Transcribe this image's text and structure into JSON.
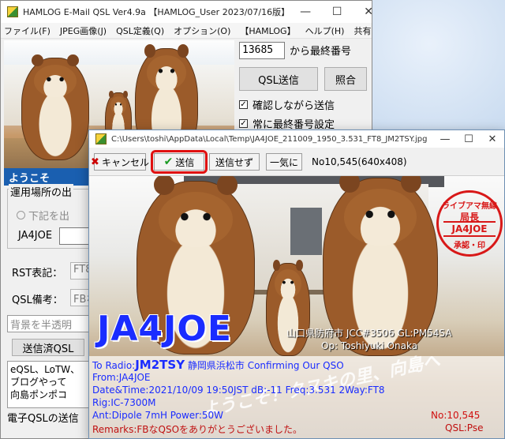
{
  "back_window": {
    "title": "HAMLOG E-Mail QSL Ver4.9a 【HAMLOG_User 2023/07/16版】",
    "caption": {
      "minimize": "—",
      "maximize": "☐",
      "close": "✕"
    },
    "menu": [
      "ファイル(F)",
      "JPEG画像(J)",
      "QSL定義(Q)",
      "オプション(O)",
      "【HAMLOG】",
      "ヘルプ(H)",
      "共有"
    ],
    "photo_sign": "ようこそ",
    "last_number_value": "13685",
    "last_number_label": "から最終番号",
    "send_qsl_button": "QSL送信",
    "verify_button": "照合",
    "check_confirm": "確認しながら送信",
    "check_always_last": "常に最終番号設定",
    "operating_place_title": "運用場所の出",
    "radio_option": "下記を出",
    "callsign_label": "JA4JOE",
    "rst_label": "RST表記：",
    "rst_value": "FT8",
    "qsl_note_label": "QSL備考：",
    "qsl_note_value": "FBな",
    "background_field": "背景を半透明",
    "sent_qsl_button": "送信済QSL",
    "memo_text": "eQSL、LoTW、\nブログやって\n向島ポンポコ",
    "status_text": "電子QSLの送信"
  },
  "front_window": {
    "title": "C:\\Users\\toshi\\AppData\\Local\\Temp\\JA4JOE_211009_1950_3.531_FT8_JM2TSY.jpg",
    "caption": {
      "minimize": "—",
      "maximize": "☐",
      "close": "✕"
    },
    "toolbar": {
      "cancel": "キャンセル",
      "send": "送信",
      "dont_send": "送信せず",
      "send_all": "一気に",
      "image_info": "No10,545(640x408)"
    },
    "card": {
      "stamp_line1": "ライブアマ無線",
      "stamp_line2": "局長",
      "stamp_line3": "JA4JOE",
      "stamp_line4": "承認・印",
      "callsign": "JA4JOE",
      "location": "山口県防府市 JCC#3506 GL:PM54SA",
      "operator": "Op: Toshiyuki Onaka",
      "banner": "ようこそ！タヌキの里、向島へ",
      "to_radio_label": "To Radio:",
      "to_radio_call": "JM2TSY",
      "to_radio_rest": " 静岡県浜松市  Confirming Our QSO",
      "from": "From:JA4JOE",
      "datetime": "Date&Time:2021/10/09 19:50JST dB:-11 Freq:3.531 2Way:FT8",
      "rig": "Rig:IC-7300M",
      "ant": "Ant:Dipole 7mH Power:50W",
      "remarks": "Remarks:FBなQSOをありがとうございました。",
      "qso_number": "No:10,545",
      "qsl": "QSL:Pse"
    }
  },
  "colors": {
    "callsign_blue": "#1a2cff",
    "highlight_red": "#e01010",
    "stamp_red": "#d81818"
  }
}
